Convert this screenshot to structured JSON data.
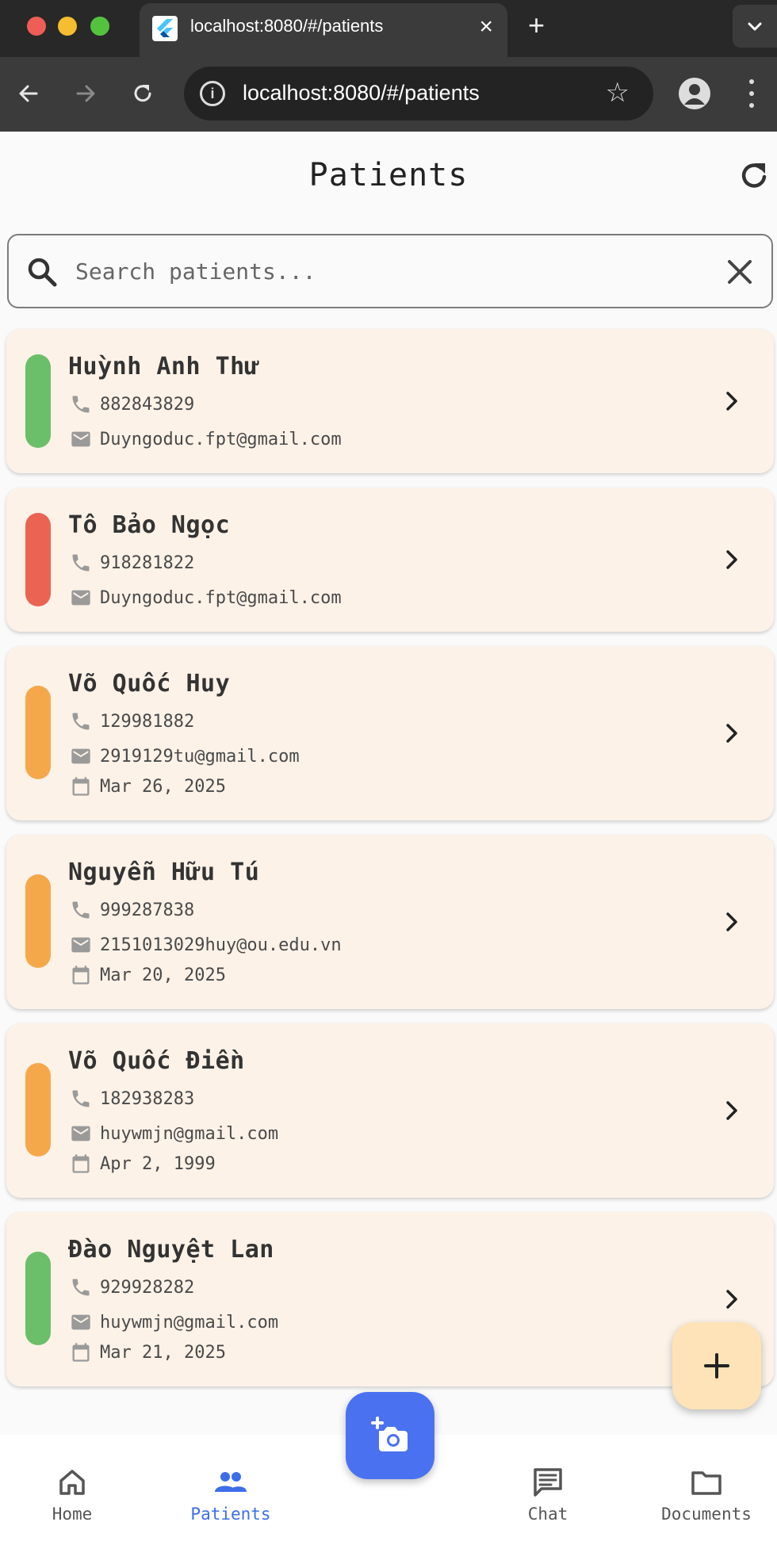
{
  "browser": {
    "tab_title": "localhost:8080/#/patients",
    "url": "localhost:8080/#/patients",
    "new_tab_label": "+",
    "close_label": "×"
  },
  "app": {
    "title": "Patients",
    "search_placeholder": "Search patients..."
  },
  "patients": [
    {
      "name": "Huỳnh Anh Thư",
      "phone": "882843829",
      "email": "Duyngoduc.fpt@gmail.com",
      "date": "",
      "status_color": "#6cbf6a"
    },
    {
      "name": "Tô Bảo Ngọc",
      "phone": "918281822",
      "email": "Duyngoduc.fpt@gmail.com",
      "date": "",
      "status_color": "#eb6352"
    },
    {
      "name": "Võ Quốc Huy",
      "phone": "129981882",
      "email": "2919129tu@gmail.com",
      "date": "Mar 26, 2025",
      "status_color": "#f5a84a"
    },
    {
      "name": "Nguyễn Hữu Tú",
      "phone": "999287838",
      "email": "2151013029huy@ou.edu.vn",
      "date": "Mar 20, 2025",
      "status_color": "#f5a84a"
    },
    {
      "name": "Võ Quốc Điền",
      "phone": "182938283",
      "email": "huywmjn@gmail.com",
      "date": "Apr 2, 1999",
      "status_color": "#f5a84a"
    },
    {
      "name": "Đào Nguyệt Lan",
      "phone": "929928282",
      "email": "huywmjn@gmail.com",
      "date": "Mar 21, 2025",
      "status_color": "#6cbf6a"
    }
  ],
  "nav": {
    "home": "Home",
    "patients": "Patients",
    "chat": "Chat",
    "documents": "Documents"
  },
  "colors": {
    "accent": "#3d6ee8",
    "card_bg": "#fcf2e8",
    "fab_bg": "#fde3b7"
  },
  "icons": {
    "refresh": "refresh-icon",
    "search": "search-icon",
    "clear": "close-icon",
    "phone": "phone-icon",
    "email": "mail-icon",
    "date": "calendar-icon",
    "open": "chevron-right-icon",
    "add": "plus-icon",
    "camera": "add-photo-icon"
  }
}
